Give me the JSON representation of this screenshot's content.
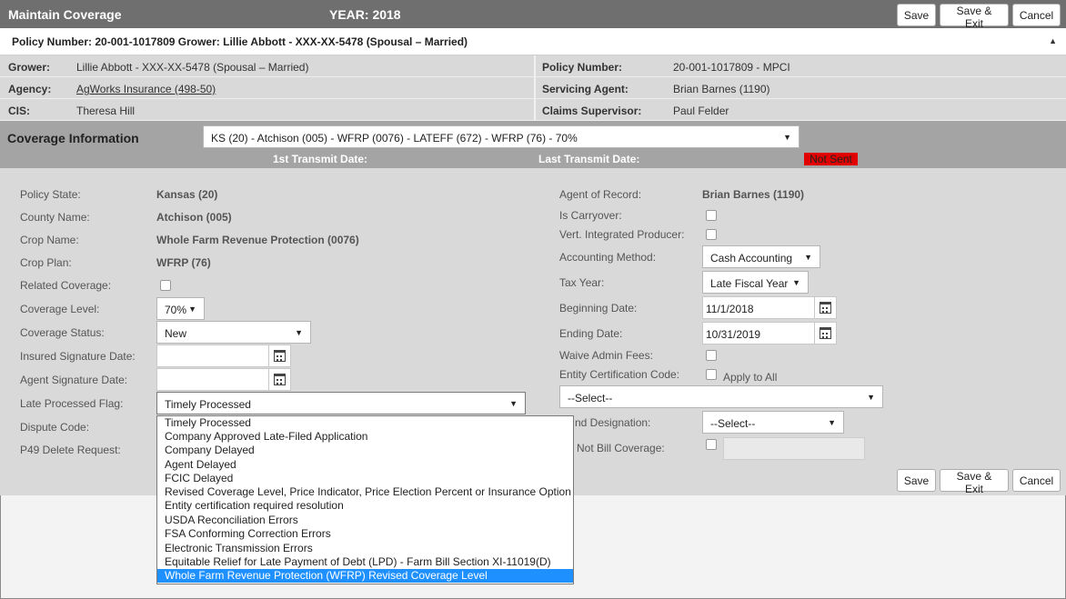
{
  "header": {
    "title": "Maintain Coverage",
    "year": "YEAR: 2018",
    "buttons": {
      "save": "Save",
      "save_exit": "Save & Exit",
      "cancel": "Cancel"
    }
  },
  "policy_bar": {
    "text": "Policy Number: 20-001-1017809 Grower: Lillie Abbott - XXX-XX-5478 (Spousal – Married)",
    "collapse_glyph": "▲"
  },
  "info": {
    "grower_label": "Grower:",
    "grower_value": "Lillie Abbott - XXX-XX-5478 (Spousal – Married)",
    "agency_label": "Agency:",
    "agency_value": "AgWorks Insurance (498-50)",
    "cis_label": "CIS:",
    "cis_value": "Theresa Hill",
    "policy_label": "Policy Number:",
    "policy_value": "20-001-1017809 - MPCI",
    "agent_label": "Servicing Agent:",
    "agent_value": "Brian Barnes (1190)",
    "claims_label": "Claims Supervisor:",
    "claims_value": "Paul Felder"
  },
  "coverage": {
    "title": "Coverage Information",
    "selector_value": "KS (20) - Atchison (005) - WFRP (0076) - LATEFF (672) - WFRP (76) - 70%",
    "first_transmit_label": "1st Transmit Date:",
    "last_transmit_label": "Last Transmit Date:",
    "status_badge": "Not Sent",
    "status_color": "#e00000"
  },
  "left_form": {
    "policy_state_label": "Policy State:",
    "policy_state_value": "Kansas (20)",
    "county_label": "County Name:",
    "county_value": "Atchison (005)",
    "crop_label": "Crop Name:",
    "crop_value": "Whole Farm Revenue Protection (0076)",
    "plan_label": "Crop Plan:",
    "plan_value": "WFRP (76)",
    "related_label": "Related Coverage:",
    "level_label": "Coverage Level:",
    "level_value": "70%",
    "status_label": "Coverage Status:",
    "status_value": "New",
    "insured_sig_label": "Insured Signature Date:",
    "agent_sig_label": "Agent Signature Date:",
    "late_flag_label": "Late Processed Flag:",
    "late_flag_value": "Timely Processed",
    "dispute_label": "Dispute Code:",
    "p49_label": "P49 Delete Request:"
  },
  "right_form": {
    "aor_label": "Agent of Record:",
    "aor_value": "Brian Barnes (1190)",
    "carryover_label": "Is Carryover:",
    "vip_label": "Vert. Integrated Producer:",
    "acct_label": "Accounting Method:",
    "acct_value": "Cash Accounting",
    "tax_label": "Tax Year:",
    "tax_value": "Late Fiscal Year",
    "begin_label": "Beginning Date:",
    "begin_value": "11/1/2018",
    "end_label": "Ending Date:",
    "end_value": "10/31/2019",
    "waive_label": "Waive Admin Fees:",
    "entity_label": "Entity Certification Code:",
    "apply_all_label": "Apply to All",
    "entity_select_value": "--Select--",
    "designation_label": "nd Designation:",
    "designation_value": "--Select--",
    "notbill_label": "Not Bill Coverage:"
  },
  "late_flag_options": [
    "Timely Processed",
    "Company Approved Late-Filed Application",
    "Company Delayed",
    "Agent Delayed",
    "FCIC Delayed",
    "Revised Coverage Level, Price Indicator, Price Election Percent or Insurance Option",
    "Entity certification required resolution",
    "USDA Reconciliation Errors",
    "FSA Conforming Correction Errors",
    "Electronic Transmission Errors",
    "Equitable Relief for Late Payment of Debt (LPD) - Farm Bill Section XI-11019(D)",
    "Whole Farm Revenue Protection (WFRP) Revised Coverage Level"
  ],
  "late_flag_highlighted": "Whole Farm Revenue Protection (WFRP) Revised Coverage Level",
  "colors": {
    "header_bg": "#6f6f6f",
    "highlight": "#1e90ff"
  }
}
